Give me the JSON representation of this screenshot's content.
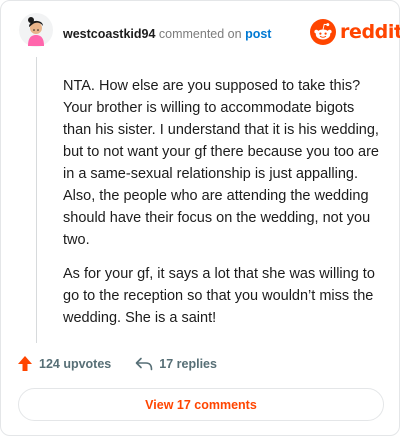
{
  "comment": {
    "username": "westcoastkid94",
    "commented_on": "commented on",
    "post_link": "post",
    "paragraphs": [
      "NTA. How else are you supposed to take this? Your brother is willing to accommodate bigots than his sister. I understand that it is his wedding, but to not want your gf there because you too are in a same-sexual relationship is just appalling. Also, the people who are attending the wedding should have their focus on the wedding, not you two.",
      "As for your gf, it says a lot that she was willing to go to the reception so that you wouldn’t miss the wedding. She is a saint!"
    ]
  },
  "brand": {
    "wordmark": "reddit",
    "icon": "reddit-alien-icon",
    "color": "#ff4500"
  },
  "actions": {
    "upvotes": "124 upvotes",
    "upvote_icon": "upvote-arrow-icon",
    "upvote_color": "#ff4500",
    "replies": "17 replies",
    "reply_icon": "reply-arrow-icon",
    "view_comments": "View 17 comments"
  },
  "avatar_icon": "user-avatar-icon"
}
